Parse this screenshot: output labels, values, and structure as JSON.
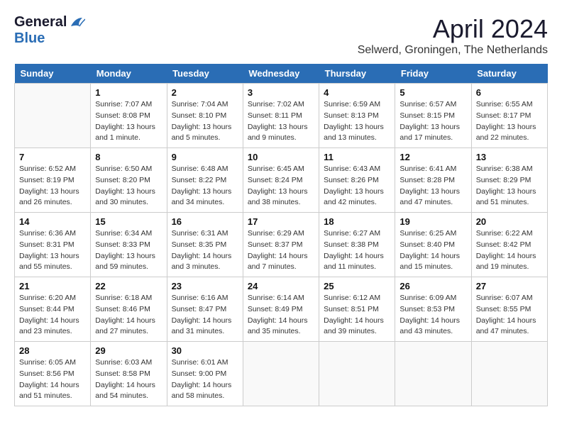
{
  "header": {
    "logo_general": "General",
    "logo_blue": "Blue",
    "month_title": "April 2024",
    "location": "Selwerd, Groningen, The Netherlands"
  },
  "days_of_week": [
    "Sunday",
    "Monday",
    "Tuesday",
    "Wednesday",
    "Thursday",
    "Friday",
    "Saturday"
  ],
  "weeks": [
    [
      {
        "day": "",
        "sunrise": "",
        "sunset": "",
        "daylight": ""
      },
      {
        "day": "1",
        "sunrise": "Sunrise: 7:07 AM",
        "sunset": "Sunset: 8:08 PM",
        "daylight": "Daylight: 13 hours and 1 minute."
      },
      {
        "day": "2",
        "sunrise": "Sunrise: 7:04 AM",
        "sunset": "Sunset: 8:10 PM",
        "daylight": "Daylight: 13 hours and 5 minutes."
      },
      {
        "day": "3",
        "sunrise": "Sunrise: 7:02 AM",
        "sunset": "Sunset: 8:11 PM",
        "daylight": "Daylight: 13 hours and 9 minutes."
      },
      {
        "day": "4",
        "sunrise": "Sunrise: 6:59 AM",
        "sunset": "Sunset: 8:13 PM",
        "daylight": "Daylight: 13 hours and 13 minutes."
      },
      {
        "day": "5",
        "sunrise": "Sunrise: 6:57 AM",
        "sunset": "Sunset: 8:15 PM",
        "daylight": "Daylight: 13 hours and 17 minutes."
      },
      {
        "day": "6",
        "sunrise": "Sunrise: 6:55 AM",
        "sunset": "Sunset: 8:17 PM",
        "daylight": "Daylight: 13 hours and 22 minutes."
      }
    ],
    [
      {
        "day": "7",
        "sunrise": "Sunrise: 6:52 AM",
        "sunset": "Sunset: 8:19 PM",
        "daylight": "Daylight: 13 hours and 26 minutes."
      },
      {
        "day": "8",
        "sunrise": "Sunrise: 6:50 AM",
        "sunset": "Sunset: 8:20 PM",
        "daylight": "Daylight: 13 hours and 30 minutes."
      },
      {
        "day": "9",
        "sunrise": "Sunrise: 6:48 AM",
        "sunset": "Sunset: 8:22 PM",
        "daylight": "Daylight: 13 hours and 34 minutes."
      },
      {
        "day": "10",
        "sunrise": "Sunrise: 6:45 AM",
        "sunset": "Sunset: 8:24 PM",
        "daylight": "Daylight: 13 hours and 38 minutes."
      },
      {
        "day": "11",
        "sunrise": "Sunrise: 6:43 AM",
        "sunset": "Sunset: 8:26 PM",
        "daylight": "Daylight: 13 hours and 42 minutes."
      },
      {
        "day": "12",
        "sunrise": "Sunrise: 6:41 AM",
        "sunset": "Sunset: 8:28 PM",
        "daylight": "Daylight: 13 hours and 47 minutes."
      },
      {
        "day": "13",
        "sunrise": "Sunrise: 6:38 AM",
        "sunset": "Sunset: 8:29 PM",
        "daylight": "Daylight: 13 hours and 51 minutes."
      }
    ],
    [
      {
        "day": "14",
        "sunrise": "Sunrise: 6:36 AM",
        "sunset": "Sunset: 8:31 PM",
        "daylight": "Daylight: 13 hours and 55 minutes."
      },
      {
        "day": "15",
        "sunrise": "Sunrise: 6:34 AM",
        "sunset": "Sunset: 8:33 PM",
        "daylight": "Daylight: 13 hours and 59 minutes."
      },
      {
        "day": "16",
        "sunrise": "Sunrise: 6:31 AM",
        "sunset": "Sunset: 8:35 PM",
        "daylight": "Daylight: 14 hours and 3 minutes."
      },
      {
        "day": "17",
        "sunrise": "Sunrise: 6:29 AM",
        "sunset": "Sunset: 8:37 PM",
        "daylight": "Daylight: 14 hours and 7 minutes."
      },
      {
        "day": "18",
        "sunrise": "Sunrise: 6:27 AM",
        "sunset": "Sunset: 8:38 PM",
        "daylight": "Daylight: 14 hours and 11 minutes."
      },
      {
        "day": "19",
        "sunrise": "Sunrise: 6:25 AM",
        "sunset": "Sunset: 8:40 PM",
        "daylight": "Daylight: 14 hours and 15 minutes."
      },
      {
        "day": "20",
        "sunrise": "Sunrise: 6:22 AM",
        "sunset": "Sunset: 8:42 PM",
        "daylight": "Daylight: 14 hours and 19 minutes."
      }
    ],
    [
      {
        "day": "21",
        "sunrise": "Sunrise: 6:20 AM",
        "sunset": "Sunset: 8:44 PM",
        "daylight": "Daylight: 14 hours and 23 minutes."
      },
      {
        "day": "22",
        "sunrise": "Sunrise: 6:18 AM",
        "sunset": "Sunset: 8:46 PM",
        "daylight": "Daylight: 14 hours and 27 minutes."
      },
      {
        "day": "23",
        "sunrise": "Sunrise: 6:16 AM",
        "sunset": "Sunset: 8:47 PM",
        "daylight": "Daylight: 14 hours and 31 minutes."
      },
      {
        "day": "24",
        "sunrise": "Sunrise: 6:14 AM",
        "sunset": "Sunset: 8:49 PM",
        "daylight": "Daylight: 14 hours and 35 minutes."
      },
      {
        "day": "25",
        "sunrise": "Sunrise: 6:12 AM",
        "sunset": "Sunset: 8:51 PM",
        "daylight": "Daylight: 14 hours and 39 minutes."
      },
      {
        "day": "26",
        "sunrise": "Sunrise: 6:09 AM",
        "sunset": "Sunset: 8:53 PM",
        "daylight": "Daylight: 14 hours and 43 minutes."
      },
      {
        "day": "27",
        "sunrise": "Sunrise: 6:07 AM",
        "sunset": "Sunset: 8:55 PM",
        "daylight": "Daylight: 14 hours and 47 minutes."
      }
    ],
    [
      {
        "day": "28",
        "sunrise": "Sunrise: 6:05 AM",
        "sunset": "Sunset: 8:56 PM",
        "daylight": "Daylight: 14 hours and 51 minutes."
      },
      {
        "day": "29",
        "sunrise": "Sunrise: 6:03 AM",
        "sunset": "Sunset: 8:58 PM",
        "daylight": "Daylight: 14 hours and 54 minutes."
      },
      {
        "day": "30",
        "sunrise": "Sunrise: 6:01 AM",
        "sunset": "Sunset: 9:00 PM",
        "daylight": "Daylight: 14 hours and 58 minutes."
      },
      {
        "day": "",
        "sunrise": "",
        "sunset": "",
        "daylight": ""
      },
      {
        "day": "",
        "sunrise": "",
        "sunset": "",
        "daylight": ""
      },
      {
        "day": "",
        "sunrise": "",
        "sunset": "",
        "daylight": ""
      },
      {
        "day": "",
        "sunrise": "",
        "sunset": "",
        "daylight": ""
      }
    ]
  ]
}
